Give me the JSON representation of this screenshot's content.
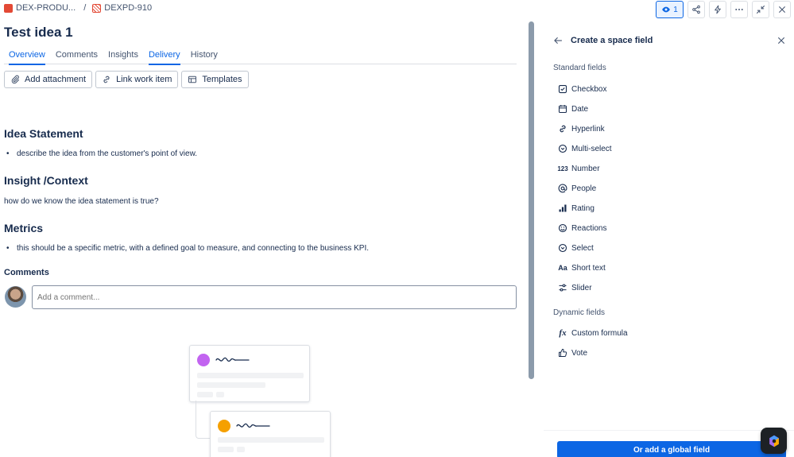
{
  "breadcrumb": {
    "project": "DEX-PRODU...",
    "separator": "/",
    "issue_key": "DEXPD-910"
  },
  "topbar": {
    "watch_count": "1"
  },
  "issue": {
    "title": "Test idea 1"
  },
  "tabs": [
    {
      "label": "Overview",
      "active": true
    },
    {
      "label": "Comments",
      "active": false
    },
    {
      "label": "Insights",
      "active": false
    },
    {
      "label": "Delivery",
      "active": true
    },
    {
      "label": "History",
      "active": false
    }
  ],
  "actions": {
    "add_attachment": "Add attachment",
    "link_work_item": "Link work item",
    "templates": "Templates"
  },
  "sections": {
    "idea_statement": {
      "heading": "Idea Statement",
      "bullet": "describe the idea from the customer's point of view."
    },
    "insight_context": {
      "heading": "Insight /Context",
      "text": "how do we know the idea statement is true?"
    },
    "metrics": {
      "heading": "Metrics",
      "bullet": "this should be a specific metric, with a defined goal to measure, and connecting to the business KPI."
    }
  },
  "comments": {
    "heading": "Comments",
    "placeholder": "Add a comment..."
  },
  "panel": {
    "title": "Create a space field",
    "standard_label": "Standard fields",
    "standard_fields": [
      {
        "label": "Checkbox",
        "icon": "checkbox-icon"
      },
      {
        "label": "Date",
        "icon": "calendar-icon"
      },
      {
        "label": "Hyperlink",
        "icon": "link-icon"
      },
      {
        "label": "Multi-select",
        "icon": "multi-select-icon"
      },
      {
        "label": "Number",
        "icon": "number-icon"
      },
      {
        "label": "People",
        "icon": "at-icon"
      },
      {
        "label": "Rating",
        "icon": "rating-icon"
      },
      {
        "label": "Reactions",
        "icon": "emoji-icon"
      },
      {
        "label": "Select",
        "icon": "select-icon"
      },
      {
        "label": "Short text",
        "icon": "text-icon"
      },
      {
        "label": "Slider",
        "icon": "slider-icon"
      }
    ],
    "dynamic_label": "Dynamic fields",
    "dynamic_fields": [
      {
        "label": "Custom formula",
        "icon": "formula-icon"
      },
      {
        "label": "Vote",
        "icon": "thumbs-up-icon"
      }
    ],
    "global_button": "Or add a global field",
    "number_glyph": "123",
    "text_glyph": "Aa",
    "formula_glyph": "fx"
  },
  "colors": {
    "accent": "#0c66e4",
    "brand_red": "#e34935",
    "purple_dot": "#c264f0",
    "orange_dot": "#f5a000"
  }
}
